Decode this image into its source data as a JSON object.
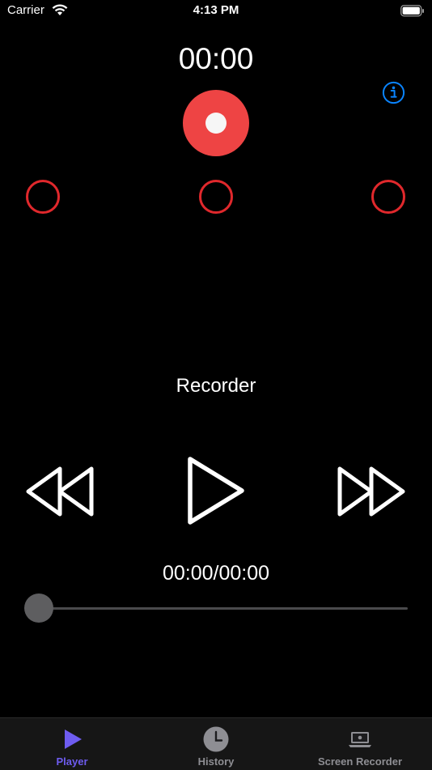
{
  "status_bar": {
    "carrier": "Carrier",
    "time": "4:13 PM"
  },
  "recorder": {
    "elapsed": "00:00",
    "markers_count": 3
  },
  "player": {
    "title": "Recorder",
    "position": "00:00/00:00",
    "progress_fraction": 0
  },
  "tabs": [
    {
      "label": "Player",
      "icon": "play-icon",
      "active": true
    },
    {
      "label": "History",
      "icon": "clock-icon",
      "active": false
    },
    {
      "label": "Screen Recorder",
      "icon": "laptop-icon",
      "active": false
    }
  ],
  "colors": {
    "record": "#ee4444",
    "marker": "#e0282c",
    "info": "#0a84ff",
    "active_tab": "#6e5cf0",
    "inactive_tab": "#8e8e93"
  }
}
